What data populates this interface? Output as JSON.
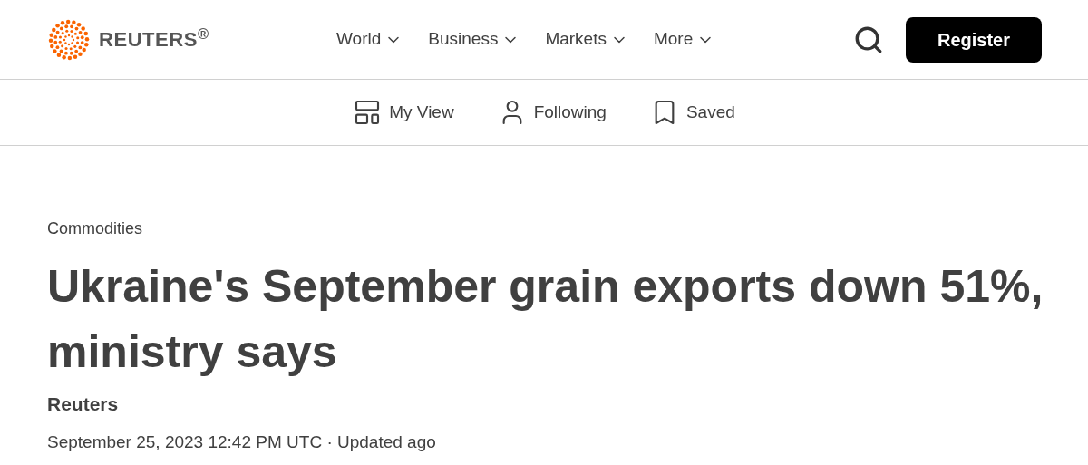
{
  "header": {
    "brand": "REUTERS$^{®}$",
    "nav": [
      {
        "label": "World"
      },
      {
        "label": "Business"
      },
      {
        "label": "Markets"
      },
      {
        "label": "More"
      }
    ],
    "register": "Register"
  },
  "subnav": [
    {
      "label": "My View",
      "kind": "layout"
    },
    {
      "label": "Following",
      "kind": "person"
    },
    {
      "label": "Saved",
      "kind": "bookmark"
    }
  ],
  "article": {
    "section": "Commodities",
    "headline": "Ukraine's September grain exports down 51%, ministry says",
    "byline": "Reuters",
    "timestamp": "September 25, 2023 12:42 PM UTC · Updated ago"
  }
}
